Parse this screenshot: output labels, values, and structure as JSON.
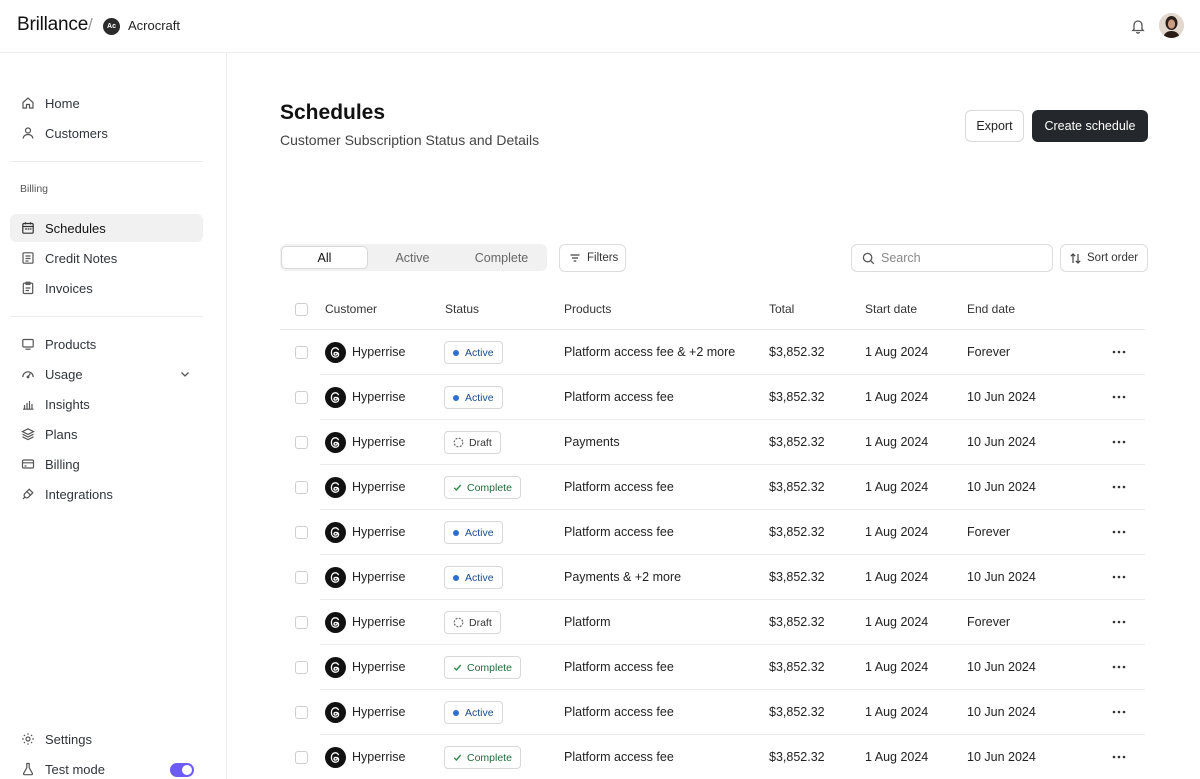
{
  "app": {
    "brand": "Brillance",
    "org_initials": "Ac",
    "org_name": "Acrocraft"
  },
  "sidebar": {
    "items_top": [
      {
        "label": "Home",
        "icon": "home-icon"
      },
      {
        "label": "Customers",
        "icon": "user-icon"
      }
    ],
    "billing_section_label": "Billing",
    "items_billing": [
      {
        "label": "Schedules",
        "icon": "calendar-icon",
        "active": true
      },
      {
        "label": "Credit Notes",
        "icon": "receipt-icon"
      },
      {
        "label": "Invoices",
        "icon": "clipboard-icon"
      }
    ],
    "items_more": [
      {
        "label": "Products",
        "icon": "box-icon"
      },
      {
        "label": "Usage",
        "icon": "gauge-icon"
      },
      {
        "label": "Insights",
        "icon": "bar-chart-icon"
      },
      {
        "label": "Plans",
        "icon": "layers-icon"
      },
      {
        "label": "Billing",
        "icon": "credit-card-icon"
      },
      {
        "label": "Integrations",
        "icon": "plug-icon"
      }
    ],
    "settings_label": "Settings",
    "test_mode_label": "Test mode",
    "test_mode_on": true
  },
  "header": {
    "title": "Schedules",
    "subtitle": "Customer Subscription Status and Details",
    "export_label": "Export",
    "create_label": "Create schedule"
  },
  "toolbar": {
    "tabs": [
      "All",
      "Active",
      "Complete"
    ],
    "selected_tab": "All",
    "filters_label": "Filters",
    "search_placeholder": "Search",
    "sort_label": "Sort order"
  },
  "table": {
    "columns": [
      "Customer",
      "Status",
      "Products",
      "Total",
      "Start date",
      "End date"
    ],
    "rows": [
      {
        "customer": "Hyperrise",
        "status": "Active",
        "products": "Platform access fee & +2 more",
        "total": "$3,852.32",
        "start": "1 Aug 2024",
        "end": "Forever"
      },
      {
        "customer": "Hyperrise",
        "status": "Active",
        "products": "Platform access fee",
        "total": "$3,852.32",
        "start": "1 Aug 2024",
        "end": "10 Jun 2024"
      },
      {
        "customer": "Hyperrise",
        "status": "Draft",
        "products": "Payments",
        "total": "$3,852.32",
        "start": "1 Aug 2024",
        "end": "10 Jun 2024"
      },
      {
        "customer": "Hyperrise",
        "status": "Complete",
        "products": "Platform access fee",
        "total": "$3,852.32",
        "start": "1 Aug 2024",
        "end": "10 Jun 2024"
      },
      {
        "customer": "Hyperrise",
        "status": "Active",
        "products": "Platform access fee",
        "total": "$3,852.32",
        "start": "1 Aug 2024",
        "end": "Forever"
      },
      {
        "customer": "Hyperrise",
        "status": "Active",
        "products": "Payments & +2 more",
        "total": "$3,852.32",
        "start": "1 Aug 2024",
        "end": "10 Jun 2024"
      },
      {
        "customer": "Hyperrise",
        "status": "Draft",
        "products": "Platform",
        "total": "$3,852.32",
        "start": "1 Aug 2024",
        "end": "Forever"
      },
      {
        "customer": "Hyperrise",
        "status": "Complete",
        "products": "Platform access fee",
        "total": "$3,852.32",
        "start": "1 Aug 2024",
        "end": "10 Jun 2024"
      },
      {
        "customer": "Hyperrise",
        "status": "Active",
        "products": "Platform access fee",
        "total": "$3,852.32",
        "start": "1 Aug 2024",
        "end": "10 Jun 2024"
      },
      {
        "customer": "Hyperrise",
        "status": "Complete",
        "products": "Platform access fee",
        "total": "$3,852.32",
        "start": "1 Aug 2024",
        "end": "10 Jun 2024"
      }
    ]
  },
  "colors": {
    "active_dot": "#2c6fd1",
    "complete_check": "#2e8a4e",
    "primary_button": "#24272b",
    "toggle": "#6d5bf5"
  }
}
